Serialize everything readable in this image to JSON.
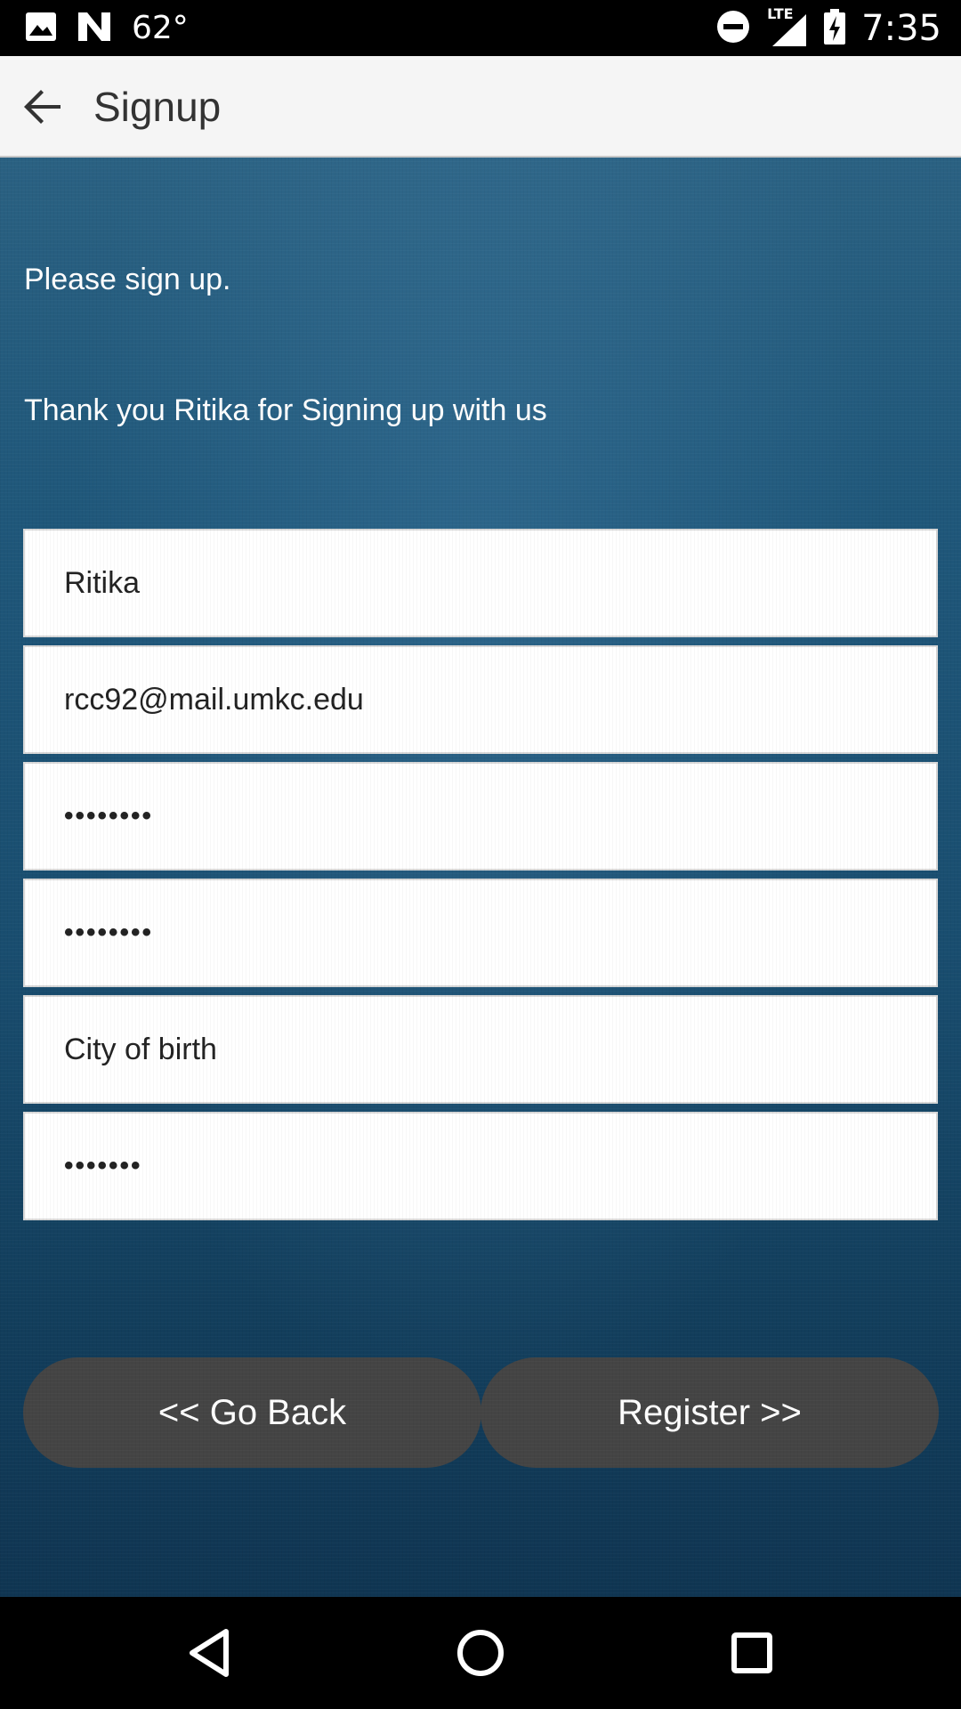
{
  "status_bar": {
    "temperature": "62°",
    "network": "LTE",
    "time": "7:35"
  },
  "app_bar": {
    "title": "Signup"
  },
  "content": {
    "prompt": "Please sign up.",
    "thank_you": "Thank you Ritika for Signing up with us"
  },
  "form": {
    "name_value": "Ritika",
    "email_value": "rcc92@mail.umkc.edu",
    "password_value": "••••••••",
    "confirm_password_value": "••••••••",
    "city_placeholder": "City of birth",
    "city_value": "",
    "security_answer_value": "•••••••"
  },
  "buttons": {
    "go_back": "<< Go Back",
    "register": "Register >>"
  },
  "colors": {
    "app_bar_bg": "#f5f5f5",
    "content_bg": "#1f577a",
    "button_bg": "#444444"
  }
}
